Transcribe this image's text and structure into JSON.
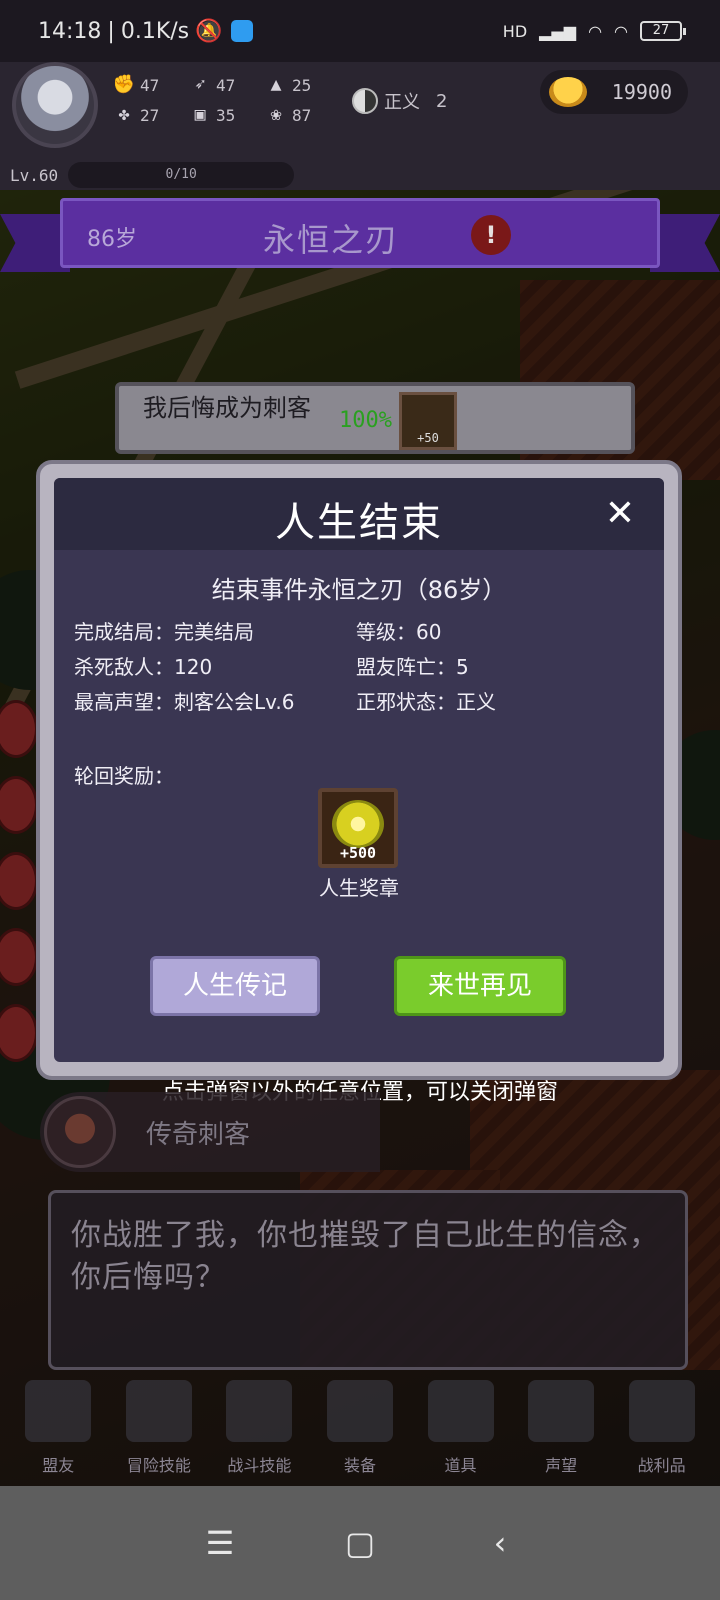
{
  "status_bar": {
    "time": "14:18",
    "network": "0.1K/s",
    "battery": "27",
    "signal_label": "HD"
  },
  "hud": {
    "stats": [
      "47",
      "47",
      "25",
      "27",
      "35",
      "87"
    ],
    "justice_label": "正义",
    "justice_value": "2",
    "gold": "19900",
    "level": "Lv.60",
    "xp": "0/10"
  },
  "banner": {
    "age": "86岁",
    "title": "永恒之刃",
    "alert": "!"
  },
  "quest": {
    "text": "我后悔成为刺客",
    "progress": "100%",
    "reward": "+50"
  },
  "modal": {
    "title": "人生结束",
    "close": "✕",
    "subtitle": "结束事件永恒之刃（86岁）",
    "info": [
      "完成结局：完美结局",
      "等级：60",
      "杀死敌人：120",
      "盟友阵亡：5",
      "最高声望：刺客公会Lv.6",
      "正邪状态：正义"
    ],
    "reward_label": "轮回奖励：",
    "medal_plus": "+500",
    "medal_name": "人生奖章",
    "btn_bio": "人生传记",
    "btn_next": "来世再见"
  },
  "hint": "点击弹窗以外的任意位置，可以关闭弹窗",
  "speaker": {
    "name": "传奇刺客"
  },
  "dialog": {
    "text": "你战胜了我，你也摧毁了自己此生的信念，你后悔吗？"
  },
  "menu": [
    {
      "label": "盟友",
      "icon": "allies-icon"
    },
    {
      "label": "冒险技能",
      "icon": "adventure-skill-icon"
    },
    {
      "label": "战斗技能",
      "icon": "battle-skill-icon"
    },
    {
      "label": "装备",
      "icon": "equipment-icon"
    },
    {
      "label": "道具",
      "icon": "items-icon"
    },
    {
      "label": "声望",
      "icon": "reputation-icon"
    },
    {
      "label": "战利品",
      "icon": "loot-icon"
    }
  ],
  "navbar": {
    "menu": "☰",
    "home": "▢",
    "back": "‹"
  }
}
